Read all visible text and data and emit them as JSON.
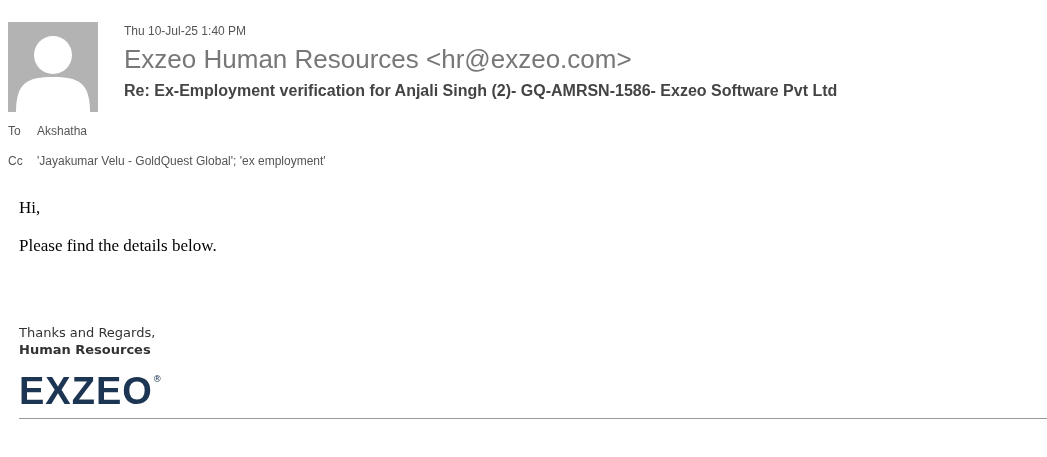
{
  "header": {
    "date": "Thu 10-Jul-25 1:40 PM",
    "sender": "Exzeo Human Resources <hr@exzeo.com>",
    "subject": "Re: Ex-Employment verification for Anjali Singh (2)- GQ-AMRSN-1586- Exzeo Software Pvt Ltd"
  },
  "recipients": [
    {
      "label": "To",
      "value": "Akshatha"
    },
    {
      "label": "Cc",
      "value": "'Jayakumar Velu - GoldQuest Global'; 'ex employment'"
    }
  ],
  "body": [
    "Hi,",
    "Please find the details below."
  ],
  "signature": {
    "closing": "Thanks and Regards,",
    "name": "Human Resources",
    "logo": "EXZEO",
    "registered": "®"
  }
}
